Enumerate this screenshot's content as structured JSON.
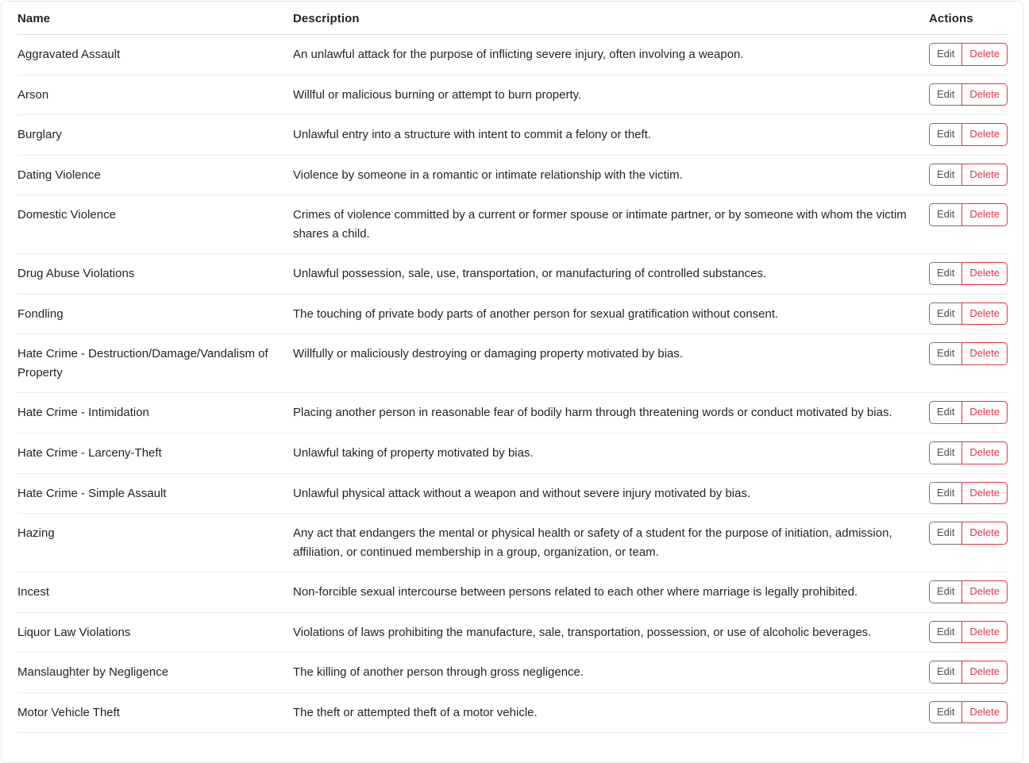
{
  "table": {
    "columns": [
      {
        "key": "name",
        "label": "Name"
      },
      {
        "key": "description",
        "label": "Description"
      },
      {
        "key": "actions",
        "label": "Actions"
      }
    ],
    "row_actions": {
      "edit_label": "Edit",
      "delete_label": "Delete"
    },
    "colors": {
      "text": "#212529",
      "edit_border": "#6c757d",
      "edit_text": "#495057",
      "delete_border": "#dc3545",
      "delete_text": "#dc3545",
      "row_divider": "#e9ecef",
      "header_divider": "#dee2e6",
      "card_border": "#e4e6e9",
      "background": "#ffffff"
    },
    "rows": [
      {
        "name": "Aggravated Assault",
        "description": "An unlawful attack for the purpose of inflicting severe injury, often involving a weapon."
      },
      {
        "name": "Arson",
        "description": "Willful or malicious burning or attempt to burn property."
      },
      {
        "name": "Burglary",
        "description": "Unlawful entry into a structure with intent to commit a felony or theft."
      },
      {
        "name": "Dating Violence",
        "description": "Violence by someone in a romantic or intimate relationship with the victim."
      },
      {
        "name": "Domestic Violence",
        "description": "Crimes of violence committed by a current or former spouse or intimate partner, or by someone with whom the victim shares a child."
      },
      {
        "name": "Drug Abuse Violations",
        "description": "Unlawful possession, sale, use, transportation, or manufacturing of controlled substances."
      },
      {
        "name": "Fondling",
        "description": "The touching of private body parts of another person for sexual gratification without consent."
      },
      {
        "name": "Hate Crime - Destruction/Damage/Vandalism of Property",
        "description": "Willfully or maliciously destroying or damaging property motivated by bias."
      },
      {
        "name": "Hate Crime - Intimidation",
        "description": "Placing another person in reasonable fear of bodily harm through threatening words or conduct motivated by bias."
      },
      {
        "name": "Hate Crime - Larceny-Theft",
        "description": "Unlawful taking of property motivated by bias."
      },
      {
        "name": "Hate Crime - Simple Assault",
        "description": "Unlawful physical attack without a weapon and without severe injury motivated by bias."
      },
      {
        "name": "Hazing",
        "description": "Any act that endangers the mental or physical health or safety of a student for the purpose of initiation, admission, affiliation, or continued membership in a group, organization, or team."
      },
      {
        "name": "Incest",
        "description": "Non-forcible sexual intercourse between persons related to each other where marriage is legally prohibited."
      },
      {
        "name": "Liquor Law Violations",
        "description": "Violations of laws prohibiting the manufacture, sale, transportation, possession, or use of alcoholic beverages."
      },
      {
        "name": "Manslaughter by Negligence",
        "description": "The killing of another person through gross negligence."
      },
      {
        "name": "Motor Vehicle Theft",
        "description": "The theft or attempted theft of a motor vehicle."
      }
    ]
  }
}
